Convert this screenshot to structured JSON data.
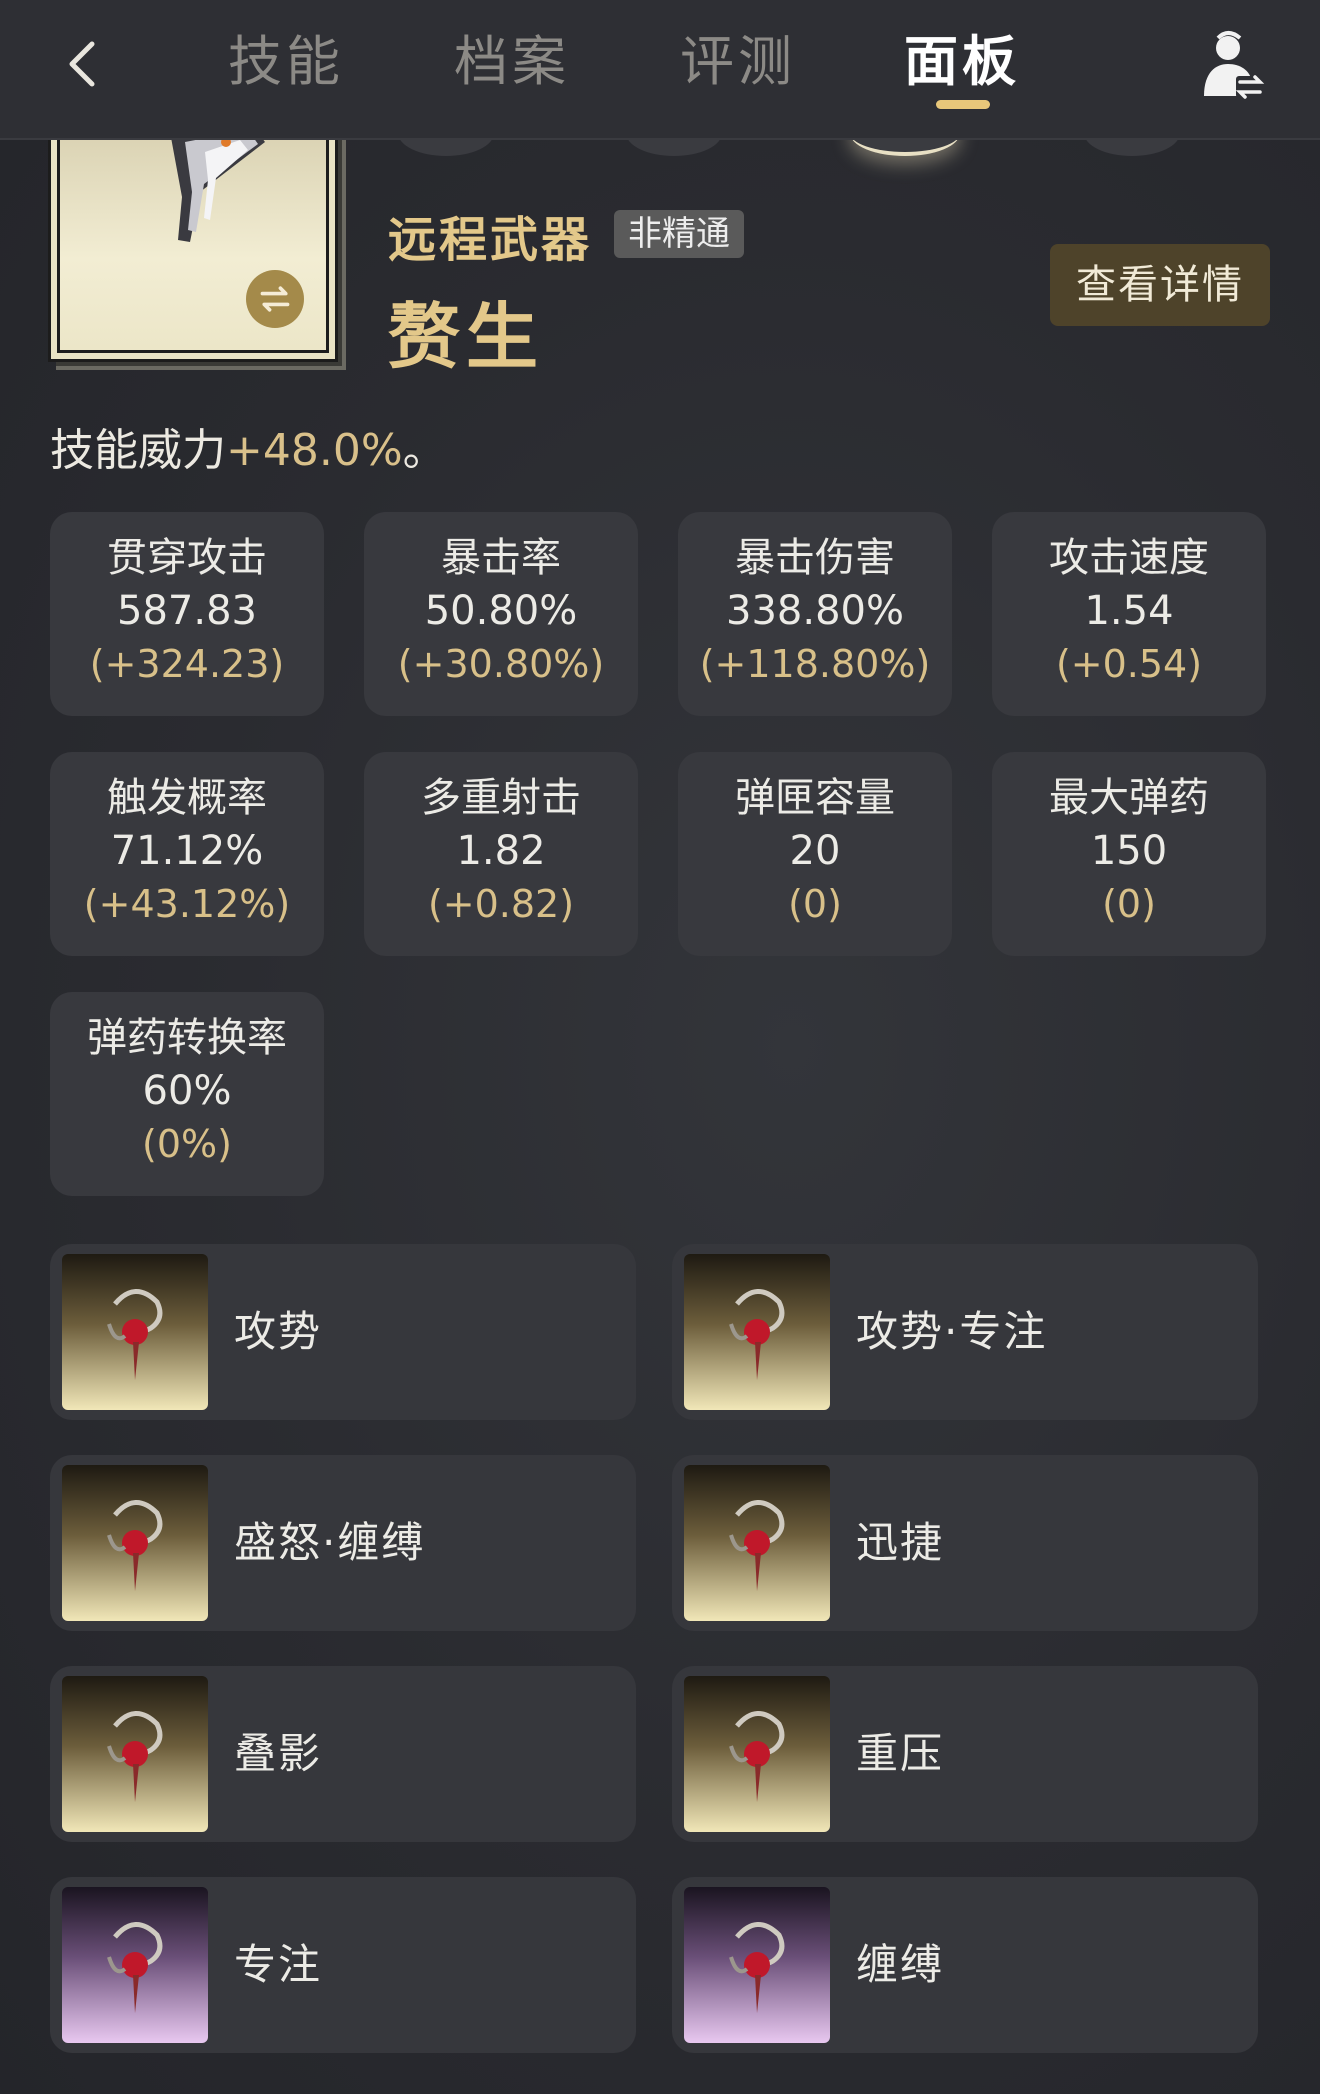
{
  "nav": {
    "tabs": [
      {
        "label": "技能"
      },
      {
        "label": "档案"
      },
      {
        "label": "评测"
      },
      {
        "label": "面板"
      }
    ],
    "active_tab": "面板"
  },
  "weapon": {
    "type": "远程武器",
    "badge": "非精通",
    "name": "赘生",
    "detail_button": "查看详情"
  },
  "skill_power": {
    "label": "技能威力",
    "value": "+48.0%",
    "suffix": "。"
  },
  "stats": [
    {
      "label": "贯穿攻击",
      "value": "587.83",
      "delta": "(+324.23)"
    },
    {
      "label": "暴击率",
      "value": "50.80%",
      "delta": "(+30.80%)"
    },
    {
      "label": "暴击伤害",
      "value": "338.80%",
      "delta": "(+118.80%)"
    },
    {
      "label": "攻击速度",
      "value": "1.54",
      "delta": "(+0.54)"
    },
    {
      "label": "触发概率",
      "value": "71.12%",
      "delta": "(+43.12%)"
    },
    {
      "label": "多重射击",
      "value": "1.82",
      "delta": "(+0.82)"
    },
    {
      "label": "弹匣容量",
      "value": "20",
      "delta": "(0)"
    },
    {
      "label": "最大弹药",
      "value": "150",
      "delta": "(0)"
    },
    {
      "label": "弹药转换率",
      "value": "60%",
      "delta": "(0%)"
    }
  ],
  "mods": [
    {
      "name": "攻势",
      "rarity": "gold"
    },
    {
      "name": "攻势·专注",
      "rarity": "gold"
    },
    {
      "name": "盛怒·缠缚",
      "rarity": "gold"
    },
    {
      "name": "迅捷",
      "rarity": "gold"
    },
    {
      "name": "叠影",
      "rarity": "gold"
    },
    {
      "name": "重压",
      "rarity": "gold"
    },
    {
      "name": "专注",
      "rarity": "purple"
    },
    {
      "name": "缠缚",
      "rarity": "purple"
    }
  ],
  "colors": {
    "accent_gold": "#e3c88a",
    "delta_gold": "#d8c089",
    "background": "#2a2b30",
    "card": "#38393e"
  },
  "icons": {
    "back": "chevron-left-icon",
    "profile": "user-switch-icon",
    "swap": "swap-arrows-icon",
    "mod": "mod-crest-icon"
  }
}
